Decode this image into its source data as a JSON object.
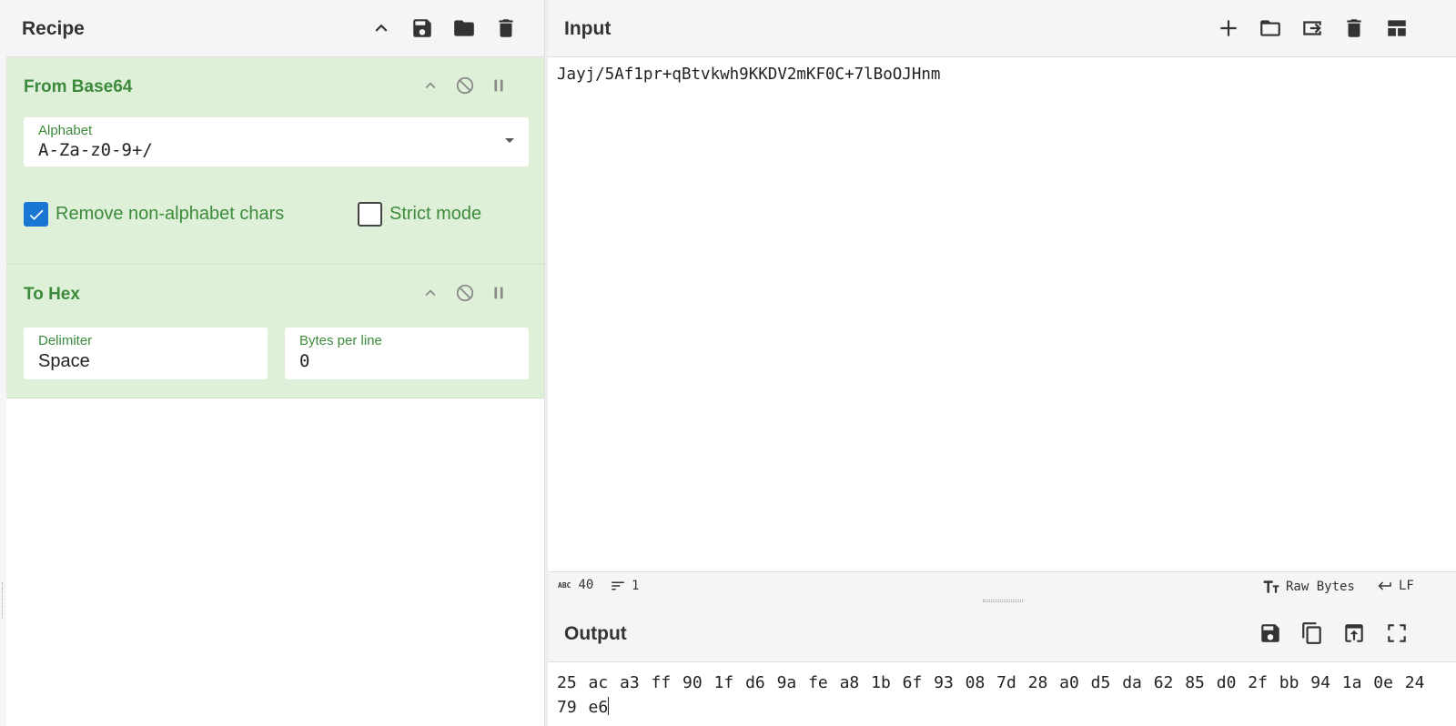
{
  "recipe": {
    "title": "Recipe",
    "header_icons": [
      "chevron-up-icon",
      "save-icon",
      "folder-icon",
      "trash-icon"
    ],
    "operations": [
      {
        "title": "From Base64",
        "alphabet_label": "Alphabet",
        "alphabet_value": "A-Za-z0-9+/",
        "remove_non_alphabet_label": "Remove non-alphabet chars",
        "remove_non_alphabet_checked": true,
        "strict_mode_label": "Strict mode",
        "strict_mode_checked": false
      },
      {
        "title": "To Hex",
        "delimiter_label": "Delimiter",
        "delimiter_value": "Space",
        "bytes_per_line_label": "Bytes per line",
        "bytes_per_line_value": "0"
      }
    ]
  },
  "input": {
    "title": "Input",
    "text": "Jayj/5Af1pr+qBtvkwh9KKDV2mKF0C+7lBoOJHnm",
    "header_icons": [
      "plus-icon",
      "folder-icon",
      "import-icon",
      "trash-icon",
      "layout-icon"
    ]
  },
  "status": {
    "char_count": "40",
    "line_count": "1",
    "encoding": "Raw Bytes",
    "eol": "LF"
  },
  "output": {
    "title": "Output",
    "text_line1": "25 ac a3 ff 90 1f d6 9a fe a8 1b 6f 93 08 7d 28 a0 d5 da 62 85 d0 2f bb 94 1a 0e 24",
    "text_line2": "79 e6",
    "header_icons": [
      "save-icon",
      "copy-icon",
      "replace-input-icon",
      "maximize-icon"
    ]
  },
  "colors": {
    "op_background": "#dff0d8",
    "op_title": "#3c8a3c",
    "checkbox_accent": "#1976d2"
  }
}
